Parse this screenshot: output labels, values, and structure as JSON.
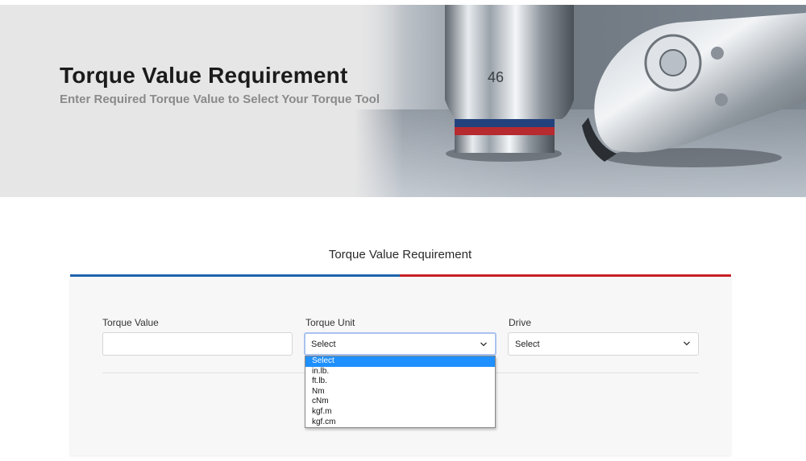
{
  "hero": {
    "title": "Torque Value Requirement",
    "subtitle": "Enter Required Torque Value to Select Your Torque Tool",
    "socket_marking": "46"
  },
  "section": {
    "title": "Torque Value Requirement"
  },
  "colors": {
    "accent_blue": "#1f64ad",
    "accent_red": "#c81f25",
    "selected_option": "#1e90ff"
  },
  "form": {
    "torque_value": {
      "label": "Torque Value",
      "value": "",
      "placeholder": ""
    },
    "torque_unit": {
      "label": "Torque Unit",
      "selected": "Select",
      "open": true,
      "options": [
        "Select",
        "in.lb.",
        "ft.lb.",
        "Nm",
        "cNm",
        "kgf.m",
        "kgf.cm"
      ]
    },
    "drive": {
      "label": "Drive",
      "selected": "Select"
    }
  },
  "icons": {
    "select_arrow": "chevron-down-icon"
  }
}
